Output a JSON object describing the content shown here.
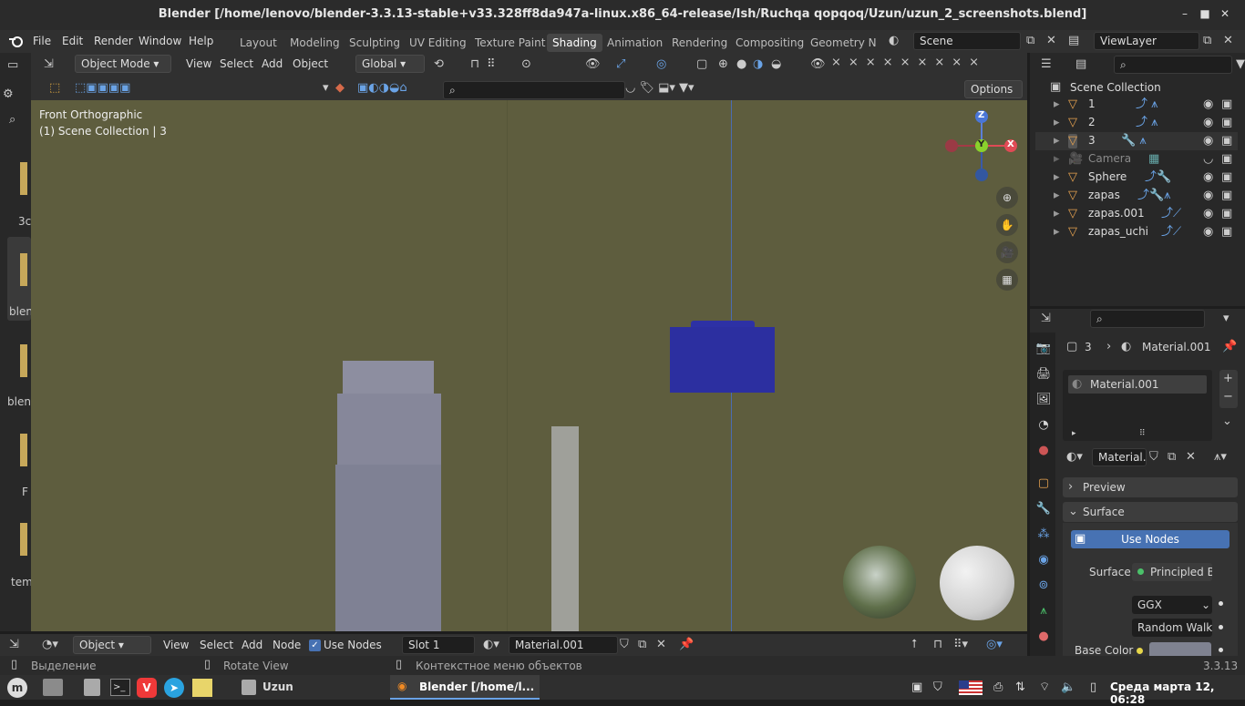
{
  "window": {
    "title": "Blender [/home/lenovo/blender-3.3.13-stable+v33.328ff8da947a-linux.x86_64-release/Ish/Ruchqa qopqoq/Uzun/uzun_2_screenshots.blend]"
  },
  "menu": [
    "File",
    "Edit",
    "Render",
    "Window",
    "Help"
  ],
  "workspaces": [
    "Layout",
    "Modeling",
    "Sculpting",
    "UV Editing",
    "Texture Paint",
    "Shading",
    "Animation",
    "Rendering",
    "Compositing",
    "Geometry Noc"
  ],
  "active_workspace": "Shading",
  "scene": "Scene",
  "view_layer": "ViewLayer",
  "viewport_header": {
    "mode": "Object Mode",
    "view": "View",
    "select": "Select",
    "add": "Add",
    "object": "Object",
    "transform": "Global",
    "options": "Options"
  },
  "viewport": {
    "view_name": "Front Orthographic",
    "collection_info": "(1) Scene Collection | 3"
  },
  "gizmo": {
    "z": "Z",
    "y": "Y",
    "x": "X"
  },
  "left_files": [
    "3c",
    "blen",
    "blend",
    "F",
    "tem"
  ],
  "outliner": {
    "root": "Scene Collection",
    "items": [
      "1",
      "2",
      "3",
      "Camera",
      "Sphere",
      "zapas",
      "zapas.001",
      "zapas_uchi"
    ]
  },
  "properties": {
    "object": "3",
    "material": "Material.001",
    "slot_item": "Material.001",
    "material_field": "Material...",
    "preview": "Preview",
    "surface": "Surface",
    "use_nodes": "Use Nodes",
    "surface_label": "Surface",
    "surface_value": "Principled B...",
    "distribution": "GGX",
    "subsurface": "Random Walk",
    "base_color": "Base Color",
    "base_color_hex": "#7f8290"
  },
  "node_header": {
    "editor": "Object",
    "view": "View",
    "select": "Select",
    "add": "Add",
    "node": "Node",
    "use_nodes": "Use Nodes",
    "slot": "Slot 1",
    "material": "Material.001"
  },
  "status": {
    "left": "Выделение",
    "mid": "Rotate View",
    "right": "Контекстное меню объектов",
    "version": "3.3.13"
  },
  "taskbar": {
    "app1": "Uzun",
    "app2": "Blender [/home/l...",
    "clock": "Среда марта 12, 06:28"
  },
  "colors": {
    "viewport_bg": "#5e5d3e",
    "accent": "#4772b3",
    "blue_object": "#2c2fa0"
  }
}
